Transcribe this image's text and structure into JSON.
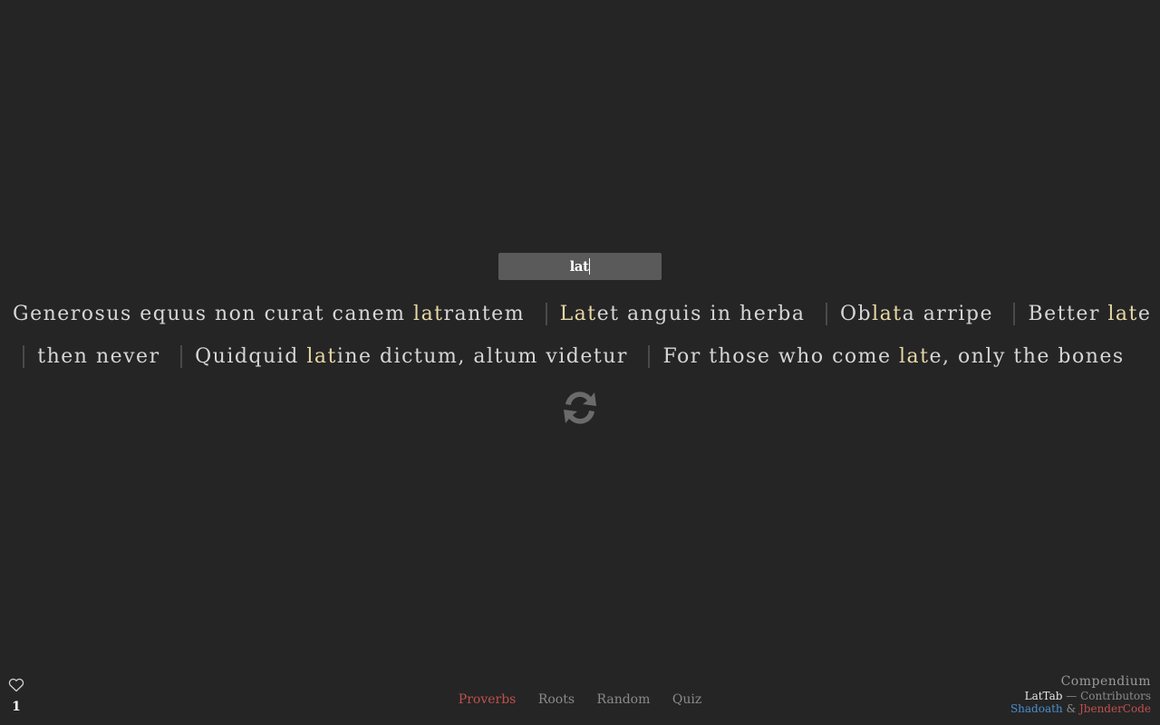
{
  "search": {
    "value": "lat"
  },
  "results": [
    {
      "pre": "Generosus equus non curat canem ",
      "match": "lat",
      "post": "rantem"
    },
    {
      "pre": "",
      "match": "Lat",
      "post": "et anguis in herba"
    },
    {
      "pre": "Ob",
      "match": "lat",
      "post": "a arripe"
    },
    {
      "pre": "Better ",
      "match": "lat",
      "post": "e then never"
    },
    {
      "pre": "Quidquid ",
      "match": "lat",
      "post": "ine dictum, altum videtur"
    },
    {
      "pre": "For those who come ",
      "match": "lat",
      "post": "e, only the bones"
    }
  ],
  "refresh_icon": "refresh-icon",
  "favorites": {
    "icon": "heart-icon",
    "count": "1"
  },
  "nav": {
    "items": [
      "Proverbs",
      "Roots",
      "Random",
      "Quiz"
    ],
    "active": "Proverbs"
  },
  "credits": {
    "compendium": "Compendium",
    "brand": "LatTab",
    "separator": " — ",
    "contributors": "Contributors",
    "author1": "Shadoath",
    "amp": " & ",
    "author2": "JbenderCode"
  },
  "colors": {
    "background": "#252525",
    "search_bg": "#5a5a5a",
    "text": "#d6d6d6",
    "highlight": "#e8d7a6",
    "active_nav": "#c0504d",
    "inactive_nav": "#8a8a8a",
    "author1": "#4a8fcf",
    "author2": "#c0504d"
  }
}
